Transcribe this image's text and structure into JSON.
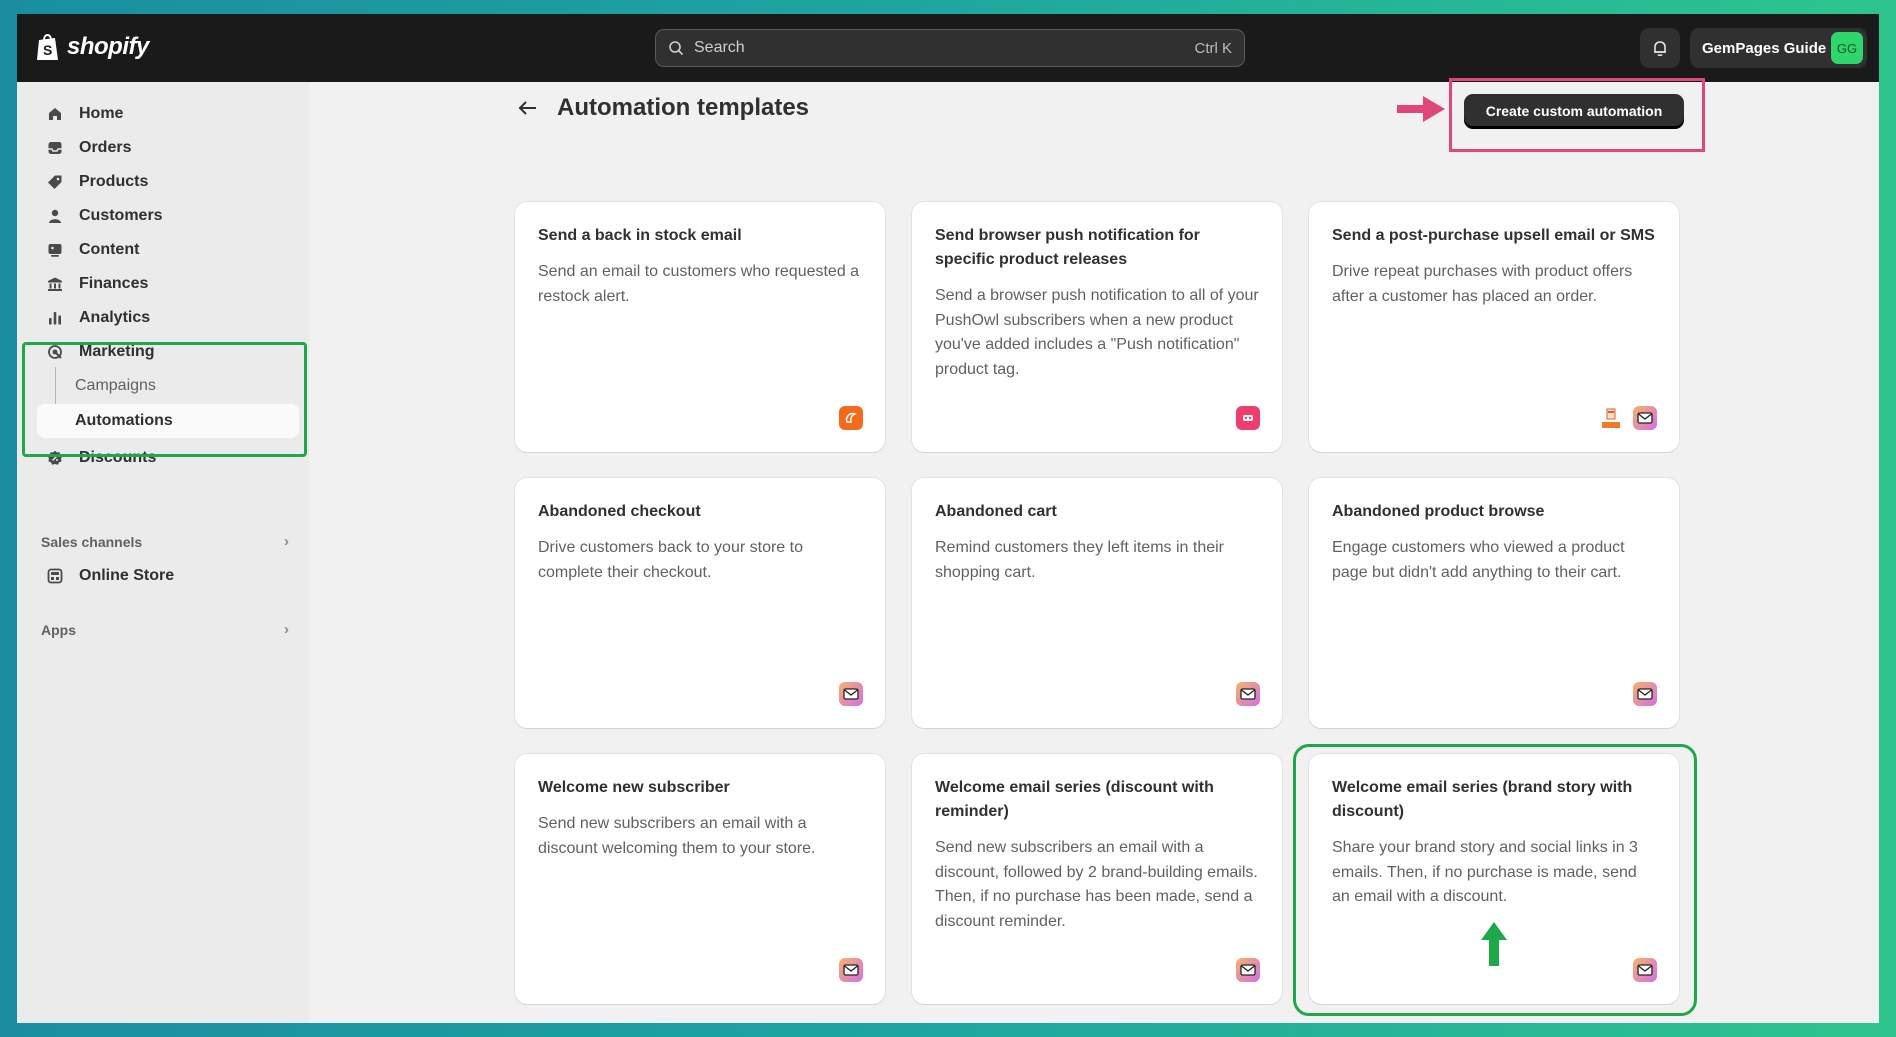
{
  "topbar": {
    "logo_text": "shopify",
    "search_placeholder": "Search",
    "search_shortcut": "Ctrl K",
    "account_name": "GemPages Guide",
    "account_initials": "GG"
  },
  "sidebar": {
    "items": [
      {
        "label": "Home",
        "icon": "home-icon"
      },
      {
        "label": "Orders",
        "icon": "inbox-icon"
      },
      {
        "label": "Products",
        "icon": "tag-icon"
      },
      {
        "label": "Customers",
        "icon": "person-icon"
      },
      {
        "label": "Content",
        "icon": "image-icon"
      },
      {
        "label": "Finances",
        "icon": "bank-icon"
      },
      {
        "label": "Analytics",
        "icon": "bar-chart-icon"
      },
      {
        "label": "Marketing",
        "icon": "target-icon"
      }
    ],
    "marketing_sub": [
      "Campaigns",
      "Automations"
    ],
    "discounts_label": "Discounts",
    "sales_channels_label": "Sales channels",
    "online_store_label": "Online Store",
    "apps_label": "Apps"
  },
  "main": {
    "title": "Automation templates",
    "create_button": "Create custom automation",
    "cards": [
      {
        "title": "Send a back in stock email",
        "desc": "Send an email to customers who requested a restock alert.",
        "icons": [
          "orange-app-icon"
        ]
      },
      {
        "title": "Send browser push notification for specific product releases",
        "desc": "Send a browser push notification to all of your PushOwl subscribers when a new product you've added includes a \"Push notification\" product tag.",
        "icons": [
          "pushowl-app-icon"
        ]
      },
      {
        "title": "Send a post-purchase upsell email or SMS",
        "desc": "Drive repeat purchases with product offers after a customer has placed an order.",
        "icons": [
          "upsell-app-icon",
          "email-app-icon"
        ]
      },
      {
        "title": "Abandoned checkout",
        "desc": "Drive customers back to your store to complete their checkout.",
        "icons": [
          "email-app-icon"
        ]
      },
      {
        "title": "Abandoned cart",
        "desc": "Remind customers they left items in their shopping cart.",
        "icons": [
          "email-app-icon"
        ]
      },
      {
        "title": "Abandoned product browse",
        "desc": "Engage customers who viewed a product page but didn't add anything to their cart.",
        "icons": [
          "email-app-icon"
        ]
      },
      {
        "title": "Welcome new subscriber",
        "desc": "Send new subscribers an email with a discount welcoming them to your store.",
        "icons": [
          "email-app-icon"
        ]
      },
      {
        "title": "Welcome email series (discount with reminder)",
        "desc": "Send new subscribers an email with a discount, followed by 2 brand-building emails. Then, if no purchase has been made, send a discount reminder.",
        "icons": [
          "email-app-icon"
        ]
      },
      {
        "title": "Welcome email series (brand story with discount)",
        "desc": "Share your brand story and social links in 3 emails. Then, if no purchase is made, send an email with a discount.",
        "icons": [
          "email-app-icon"
        ]
      }
    ]
  },
  "colors": {
    "highlight_green": "#1fa84a",
    "highlight_pink": "#e0467a"
  }
}
